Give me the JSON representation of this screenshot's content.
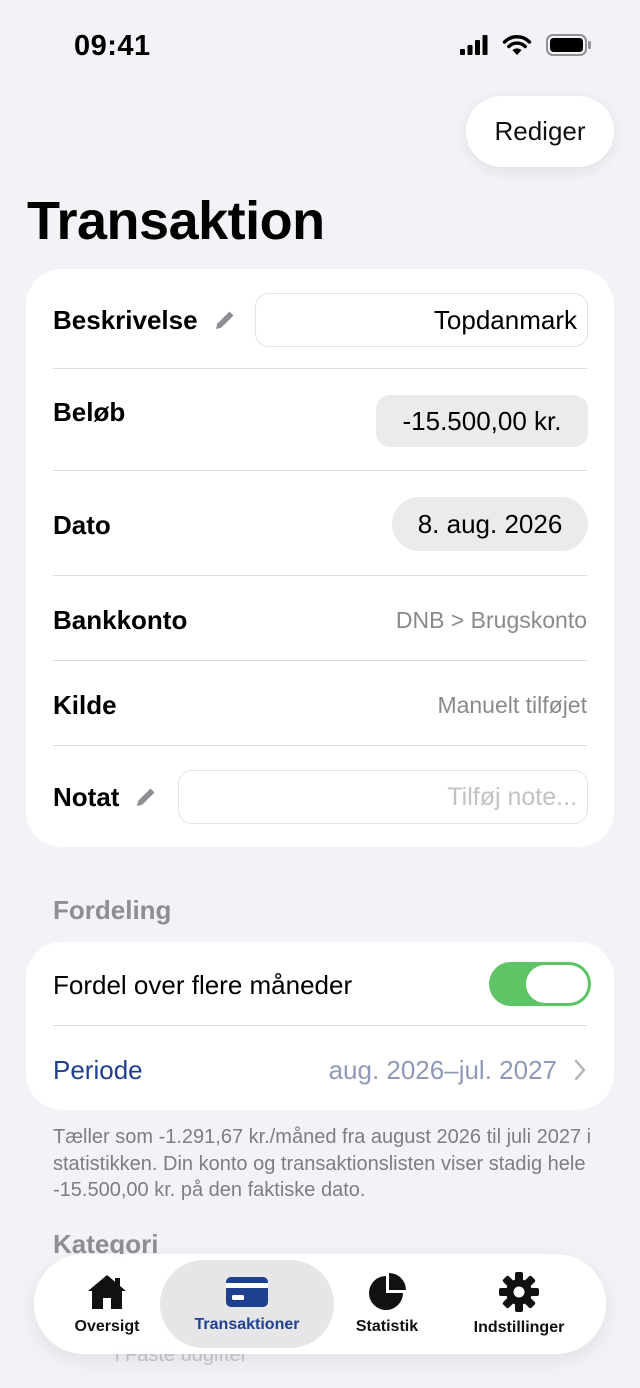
{
  "status": {
    "time": "09:41"
  },
  "header": {
    "edit_label": "Rediger",
    "title": "Transaktion"
  },
  "details": {
    "description": {
      "label": "Beskrivelse",
      "value": "Topdanmark"
    },
    "amount": {
      "label": "Beløb",
      "value": "-15.500,00 kr."
    },
    "date": {
      "label": "Dato",
      "value": "8. aug. 2026"
    },
    "bank_account": {
      "label": "Bankkonto",
      "value": "DNB > Brugskonto"
    },
    "source": {
      "label": "Kilde",
      "value": "Manuelt tilføjet"
    },
    "note": {
      "label": "Notat",
      "placeholder": "Tilføj note..."
    }
  },
  "distribution": {
    "section_title": "Fordeling",
    "toggle_label": "Fordel over flere måneder",
    "toggle_on": true,
    "period_label": "Periode",
    "period_value": "aug. 2026–jul. 2027",
    "footnote": "Tæller som -1.291,67 kr./måned fra august 2026 til juli 2027 i statistikken. Din konto og transaktionslisten viser stadig hele -15.500,00 kr. på den faktiske dato."
  },
  "category": {
    "section_title": "Kategori",
    "partial_value": "i Faste udgifter"
  },
  "tabbar": {
    "tabs": [
      {
        "label": "Oversigt",
        "icon": "home-icon",
        "active": false
      },
      {
        "label": "Transaktioner",
        "icon": "card-icon",
        "active": true
      },
      {
        "label": "Statistik",
        "icon": "pie-chart-icon",
        "active": false
      },
      {
        "label": "Indstillinger",
        "icon": "gear-icon",
        "active": false
      }
    ]
  },
  "colors": {
    "accent": "#1f3f8f",
    "toggle_on": "#5fc466",
    "background": "#f2f2f7"
  }
}
